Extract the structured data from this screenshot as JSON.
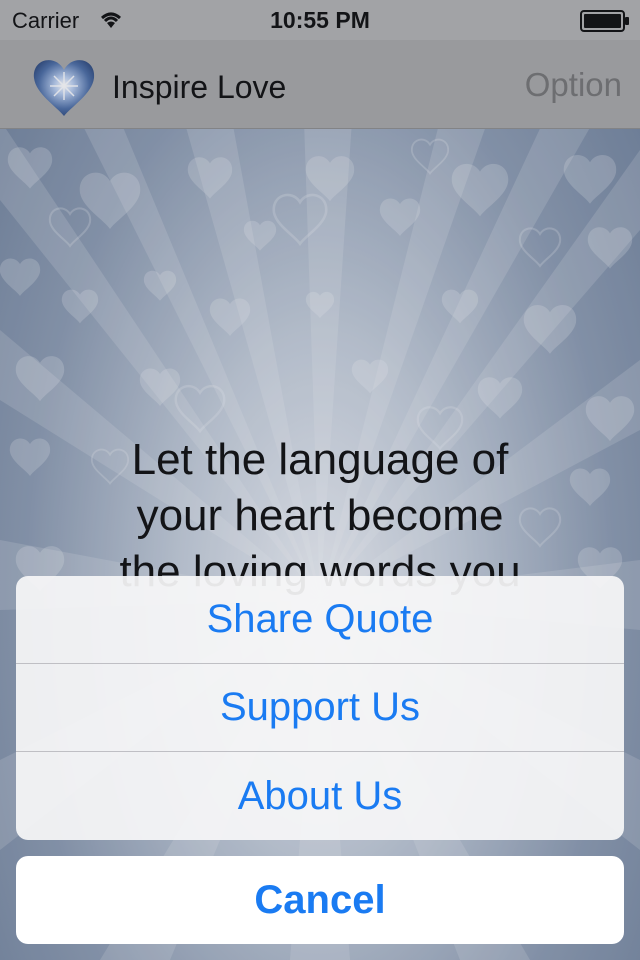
{
  "status_bar": {
    "carrier": "Carrier",
    "time": "10:55 PM",
    "wifi_icon": "wifi-icon",
    "battery_icon": "battery-icon"
  },
  "nav": {
    "logo_icon": "glowing-heart-icon",
    "title": "Inspire Love",
    "option_label": "Option"
  },
  "quote": {
    "line1": "Let the language of",
    "line2": "your heart become",
    "line3": "the loving words you"
  },
  "action_sheet": {
    "items": [
      {
        "label": "Share Quote"
      },
      {
        "label": "Support Us"
      },
      {
        "label": "About Us"
      }
    ],
    "cancel_label": "Cancel"
  },
  "colors": {
    "accent": "#1a7bf2",
    "nav_background": "#a9a9a9",
    "status_background": "#b3b3b3"
  }
}
